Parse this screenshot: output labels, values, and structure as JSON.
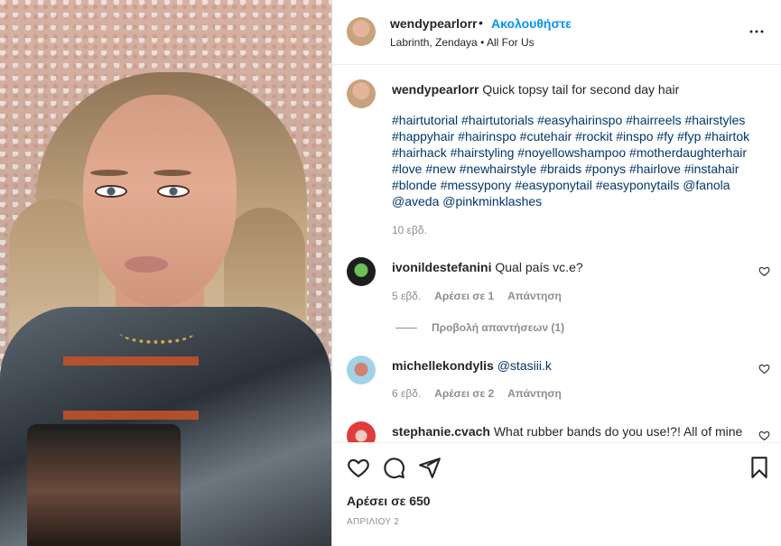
{
  "post": {
    "image_alt": "video",
    "header": {
      "username": "wendypearlorr",
      "separator": "•",
      "follow_label": "Ακολουθήστε",
      "audio": "Labrinth, Zendaya • All For Us"
    },
    "caption": {
      "username": "wendypearlorr",
      "text": "Quick topsy tail for second day hair",
      "hashtags": "#hairtutorial #hairtutorials #easyhairinspo #hairreels #hairstyles #happyhair #hairinspo #cutehair #rockit #inspo #fy #fyp #hairtok #hairhack #hairstyling #noyellowshampoo #motherdaughterhair #love #new #newhairstyle #braids #ponys #hairlove #instahair #blonde #messypony #easyponytail #easyponytails @fanola @aveda @pinkminklashes",
      "age": "10 εβδ."
    },
    "comments": [
      {
        "username": "ivonildestefanini",
        "text": "Qual país vc.e?",
        "age": "5 εβδ.",
        "likes": "Αρέσει σε 1",
        "reply_label": "Απάντηση",
        "view_replies": "Προβολή απαντήσεων (1)"
      },
      {
        "username": "michellekondylis",
        "text": "@stasiii.k",
        "age": "6 εβδ.",
        "likes": "Αρέσει σε 2",
        "reply_label": "Απάντηση"
      },
      {
        "username": "stephanie.cvach",
        "text": "What rubber bands do you use!?! All of mine"
      }
    ],
    "footer": {
      "likes": "Αρέσει σε 650",
      "date": "ΑΠΡΙΛΙΟΥ 2"
    },
    "icons": {
      "more": "more-options-icon",
      "like": "heart-icon",
      "comment": "comment-icon",
      "share": "send-icon",
      "save": "bookmark-icon"
    },
    "colors": {
      "accent": "#0095f6",
      "hashtag": "#00376b",
      "muted": "#8e8e8e",
      "text": "#262626"
    }
  }
}
